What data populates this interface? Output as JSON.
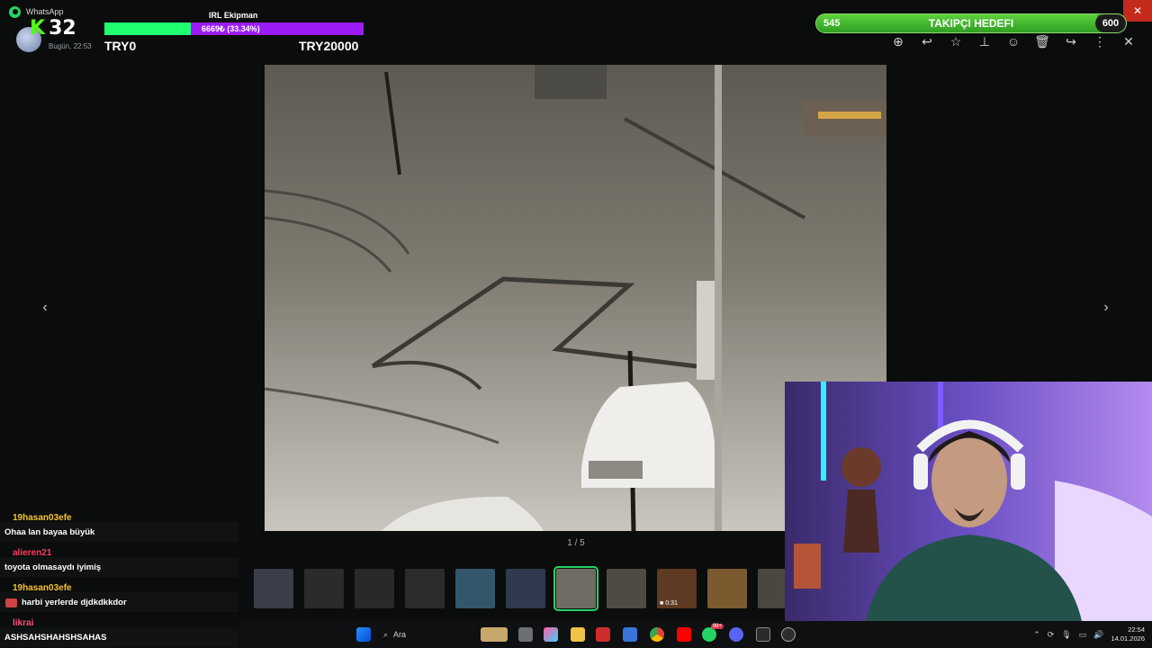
{
  "window": {
    "app_title": "WhatsApp",
    "close": "✕"
  },
  "sender": {
    "time": "Bugün, 22:53"
  },
  "kick": {
    "viewer_count": "32"
  },
  "donation_goal": {
    "title": "IRL Ekipman",
    "progress_text": "6669₺ (33.34%)",
    "progress": 0.3334,
    "current": "TRY0",
    "target": "TRY20000",
    "bar_color": "#9b1cf7",
    "fill_color": "#20ff70"
  },
  "follower_goal": {
    "current": "545",
    "label": "TAKIPÇI HEDEFI",
    "target": "600",
    "progress": 0.908
  },
  "toolbar": {
    "items": [
      {
        "icon": "zoom-in-icon",
        "glyph": "⊕"
      },
      {
        "icon": "reply-icon",
        "glyph": "↩"
      },
      {
        "icon": "star-icon",
        "glyph": "☆"
      },
      {
        "icon": "pin-icon",
        "glyph": "⊥"
      },
      {
        "icon": "emoji-icon",
        "glyph": "☺"
      },
      {
        "icon": "delete-icon",
        "glyph": "🗑"
      },
      {
        "icon": "forward-icon",
        "glyph": "↪"
      },
      {
        "icon": "more-options-icon",
        "glyph": "⋮"
      },
      {
        "icon": "close-icon",
        "glyph": "✕"
      }
    ]
  },
  "viewer": {
    "counter": "1 / 5",
    "prev": "‹",
    "next": "›"
  },
  "thumbnails": {
    "video_duration": "0:31"
  },
  "chat": {
    "messages": [
      {
        "user": "19hasan03efe",
        "user_color": "#f4c430",
        "text": "Ohaa lan bayaa büyük"
      },
      {
        "user": "alieren21",
        "user_color": "#ff3b5c",
        "text": "toyota olmasaydı iyimiş"
      },
      {
        "user": "19hasan03efe",
        "user_color": "#f4c430",
        "text": "harbi yerlerde djdkdkkdor"
      },
      {
        "user": "likrai",
        "user_color": "#ff4f7a",
        "text": "ASHSAHSHAHSHSAHAS"
      }
    ]
  },
  "taskbar": {
    "search_label": "Ara",
    "whatsapp_badge": "99+",
    "time": "22:54",
    "date": "14.01.2026"
  }
}
